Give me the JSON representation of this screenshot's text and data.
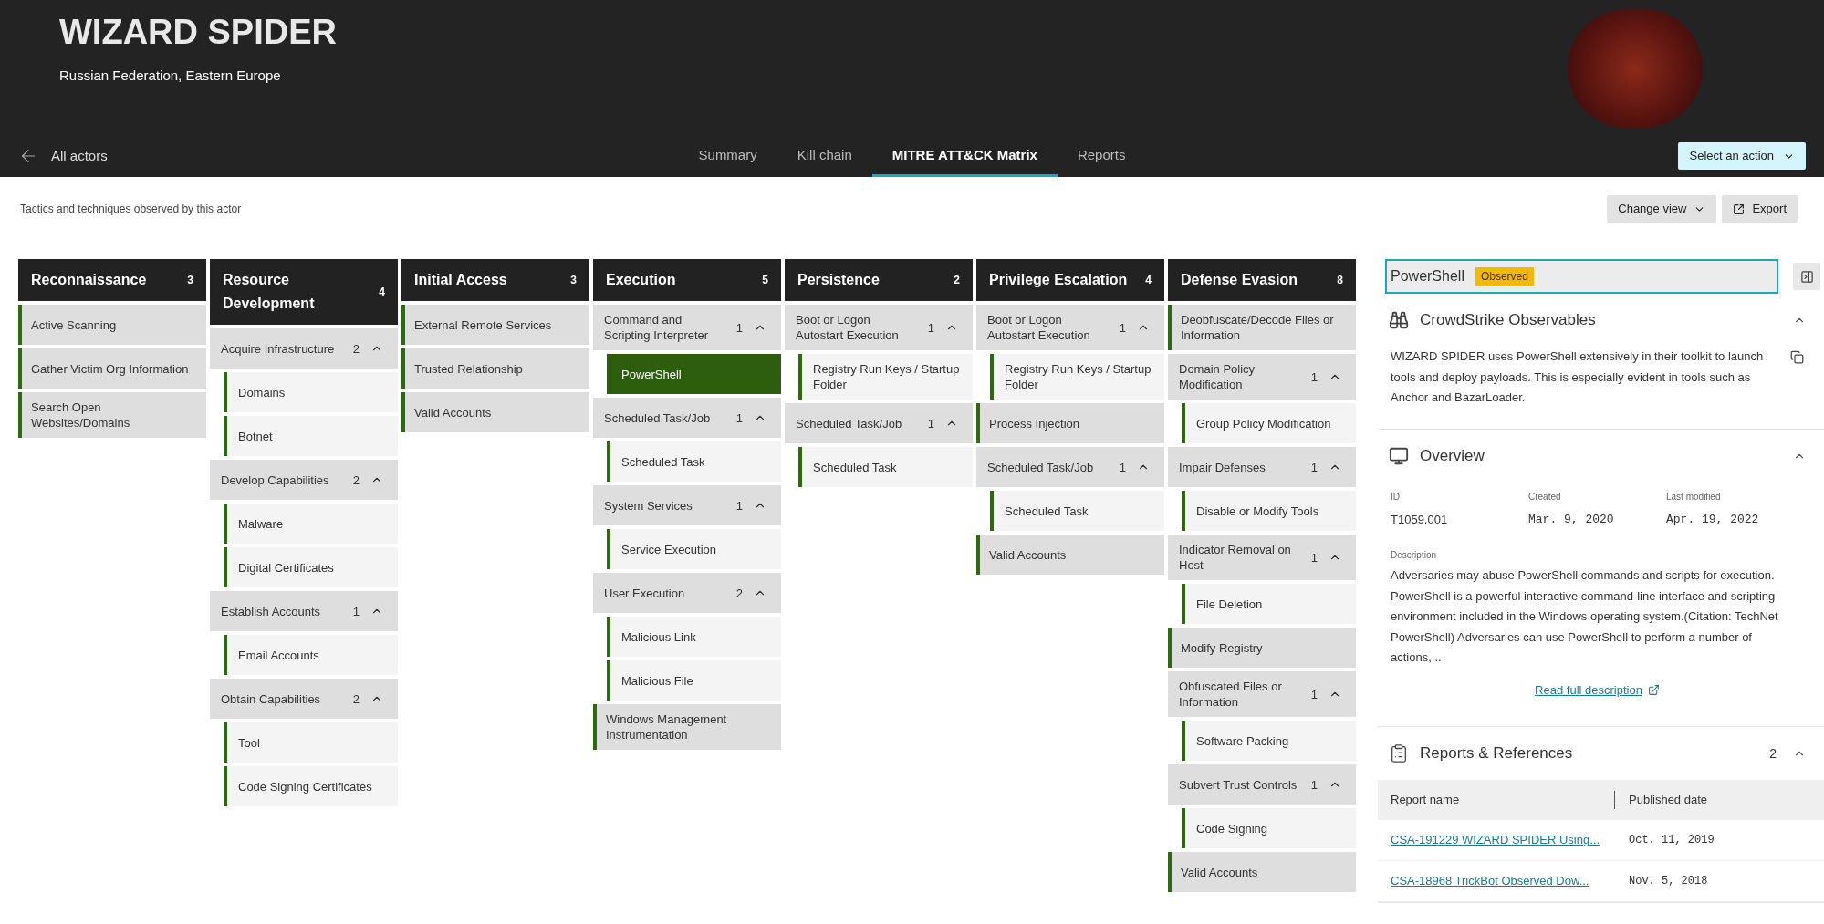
{
  "actor": {
    "name": "WIZARD SPIDER",
    "location": "Russian Federation, Eastern Europe"
  },
  "nav": {
    "back": "All actors",
    "tabs": [
      {
        "label": "Summary",
        "selected": false
      },
      {
        "label": "Kill chain",
        "selected": false
      },
      {
        "label": "MITRE ATT&CK Matrix",
        "selected": true
      },
      {
        "label": "Reports",
        "selected": false
      }
    ],
    "action_button": "Select an action"
  },
  "toolbar": {
    "caption": "Tactics and techniques observed by this actor",
    "buttons": [
      {
        "label": "Change view",
        "kind": "dropdown"
      },
      {
        "label": "Export",
        "kind": "export"
      }
    ]
  },
  "tactics": [
    {
      "name": "Reconnaissance",
      "count": "3",
      "techniques": [
        {
          "name": "Active Scanning",
          "selected": false
        },
        {
          "name": "Gather Victim Org Information",
          "selected": false
        },
        {
          "name": "Search Open Websites/Domains",
          "selected": false
        }
      ]
    },
    {
      "name": "Resource Development",
      "count": "4",
      "techniques": [
        {
          "name": "Acquire Infrastructure",
          "count": "2",
          "expanded": true,
          "selected": false,
          "children": [
            {
              "name": "Domains",
              "selected": false
            },
            {
              "name": "Botnet",
              "selected": false
            }
          ]
        },
        {
          "name": "Develop Capabilities",
          "count": "2",
          "expanded": true,
          "selected": false,
          "children": [
            {
              "name": "Malware",
              "selected": false
            },
            {
              "name": "Digital Certificates",
              "selected": false
            }
          ]
        },
        {
          "name": "Establish Accounts",
          "count": "1",
          "expanded": true,
          "selected": false,
          "children": [
            {
              "name": "Email Accounts",
              "selected": false
            }
          ]
        },
        {
          "name": "Obtain Capabilities",
          "count": "2",
          "expanded": true,
          "selected": false,
          "children": [
            {
              "name": "Tool",
              "selected": false
            },
            {
              "name": "Code Signing Certificates",
              "selected": false
            }
          ]
        }
      ]
    },
    {
      "name": "Initial Access",
      "count": "3",
      "techniques": [
        {
          "name": "External Remote Services",
          "selected": false
        },
        {
          "name": "Trusted Relationship",
          "selected": false
        },
        {
          "name": "Valid Accounts",
          "selected": false
        }
      ]
    },
    {
      "name": "Execution",
      "count": "5",
      "techniques": [
        {
          "name": "Command and Scripting Interpreter",
          "count": "1",
          "expanded": true,
          "selected": false,
          "children": [
            {
              "name": "PowerShell",
              "selected": true
            }
          ]
        },
        {
          "name": "Scheduled Task/Job",
          "count": "1",
          "expanded": true,
          "selected": false,
          "children": [
            {
              "name": "Scheduled Task",
              "selected": false
            }
          ]
        },
        {
          "name": "System Services",
          "count": "1",
          "expanded": true,
          "selected": false,
          "children": [
            {
              "name": "Service Execution",
              "selected": false
            }
          ]
        },
        {
          "name": "User Execution",
          "count": "2",
          "expanded": true,
          "selected": false,
          "children": [
            {
              "name": "Malicious Link",
              "selected": false
            },
            {
              "name": "Malicious File",
              "selected": false
            }
          ]
        },
        {
          "name": "Windows Management Instrumentation",
          "selected": false
        }
      ]
    },
    {
      "name": "Persistence",
      "count": "2",
      "techniques": [
        {
          "name": "Boot or Logon Autostart Execution",
          "count": "1",
          "expanded": true,
          "selected": false,
          "children": [
            {
              "name": "Registry Run Keys / Startup Folder",
              "selected": false
            }
          ]
        },
        {
          "name": "Scheduled Task/Job",
          "count": "1",
          "expanded": true,
          "selected": false,
          "children": [
            {
              "name": "Scheduled Task",
              "selected": false
            }
          ]
        }
      ]
    },
    {
      "name": "Privilege Escalation",
      "count": "4",
      "techniques": [
        {
          "name": "Boot or Logon Autostart Execution",
          "count": "1",
          "expanded": true,
          "selected": false,
          "children": [
            {
              "name": "Registry Run Keys / Startup Folder",
              "selected": false
            }
          ]
        },
        {
          "name": "Process Injection",
          "selected": false
        },
        {
          "name": "Scheduled Task/Job",
          "count": "1",
          "expanded": true,
          "selected": false,
          "children": [
            {
              "name": "Scheduled Task",
              "selected": false
            }
          ]
        },
        {
          "name": "Valid Accounts",
          "selected": false
        }
      ]
    },
    {
      "name": "Defense Evasion",
      "count": "8",
      "techniques": [
        {
          "name": "Deobfuscate/Decode Files or Information",
          "selected": false
        },
        {
          "name": "Domain Policy Modification",
          "count": "1",
          "expanded": true,
          "selected": false,
          "children": [
            {
              "name": "Group Policy Modification",
              "selected": false
            }
          ]
        },
        {
          "name": "Impair Defenses",
          "count": "1",
          "expanded": true,
          "selected": false,
          "children": [
            {
              "name": "Disable or Modify Tools",
              "selected": false
            }
          ]
        },
        {
          "name": "Indicator Removal on Host",
          "count": "1",
          "expanded": true,
          "selected": false,
          "children": [
            {
              "name": "File Deletion",
              "selected": false
            }
          ]
        },
        {
          "name": "Modify Registry",
          "selected": false
        },
        {
          "name": "Obfuscated Files or Information",
          "count": "1",
          "expanded": true,
          "selected": false,
          "children": [
            {
              "name": "Software Packing",
              "selected": false
            }
          ]
        },
        {
          "name": "Subvert Trust Controls",
          "count": "1",
          "expanded": true,
          "selected": false,
          "children": [
            {
              "name": "Code Signing",
              "selected": false
            }
          ]
        },
        {
          "name": "Valid Accounts",
          "selected": false
        }
      ]
    }
  ],
  "detail": {
    "search": {
      "value": "PowerShell",
      "badge": "Observed"
    },
    "observables": {
      "title": "CrowdStrike Observables",
      "expanded": true,
      "text": "WIZARD SPIDER uses PowerShell extensively in their toolkit to launch tools and deploy payloads. This is especially evident in tools such as Anchor and BazarLoader."
    },
    "overview": {
      "title": "Overview",
      "expanded": true,
      "fields": [
        {
          "label": "ID",
          "value": "T1059.001",
          "kind": "text"
        },
        {
          "label": "Created",
          "value": "Mar. 9, 2020",
          "kind": "date"
        },
        {
          "label": "Last modified",
          "value": "Apr. 19, 2022",
          "kind": "date"
        }
      ],
      "description_label": "Description",
      "description": "Adversaries may abuse PowerShell commands and scripts for execution. PowerShell is a powerful interactive command-line interface and scripting environment included in the Windows operating system.(Citation: TechNet PowerShell) Adversaries can use PowerShell to perform a number of actions,...",
      "link": "Read full description"
    },
    "reports": {
      "title": "Reports & References",
      "count": "2",
      "expanded": true,
      "columns": [
        "Report name",
        "Published date"
      ],
      "rows": [
        {
          "name": "CSA-191229 WIZARD SPIDER Using...",
          "date": "Oct. 11, 2019"
        },
        {
          "name": "CSA-18968 TrickBot Observed Dow...",
          "date": "Nov. 5, 2018"
        }
      ]
    }
  }
}
